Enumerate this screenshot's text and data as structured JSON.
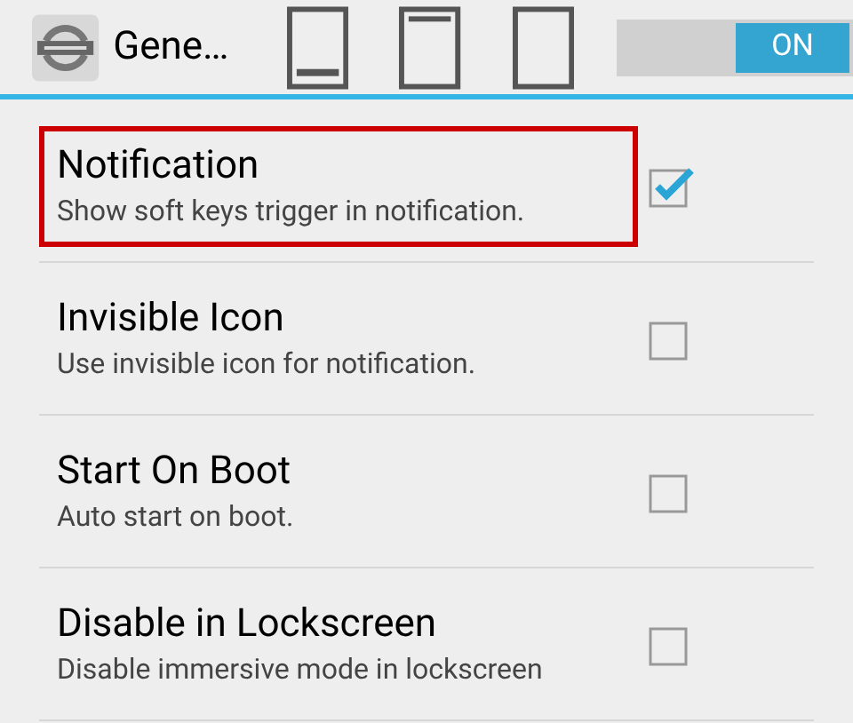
{
  "action_bar": {
    "title": "Gene…",
    "toggle": {
      "label": "ON",
      "on": true
    }
  },
  "settings": [
    {
      "title": "Notification",
      "summary": "Show soft keys trigger in notification.",
      "checked": true,
      "highlighted": true
    },
    {
      "title": "Invisible Icon",
      "summary": "Use invisible icon for notification.",
      "checked": false,
      "highlighted": false
    },
    {
      "title": "Start On Boot",
      "summary": "Auto start on boot.",
      "checked": false,
      "highlighted": false
    },
    {
      "title": "Disable in Lockscreen",
      "summary": "Disable immersive mode in lockscreen",
      "checked": false,
      "highlighted": false
    }
  ]
}
